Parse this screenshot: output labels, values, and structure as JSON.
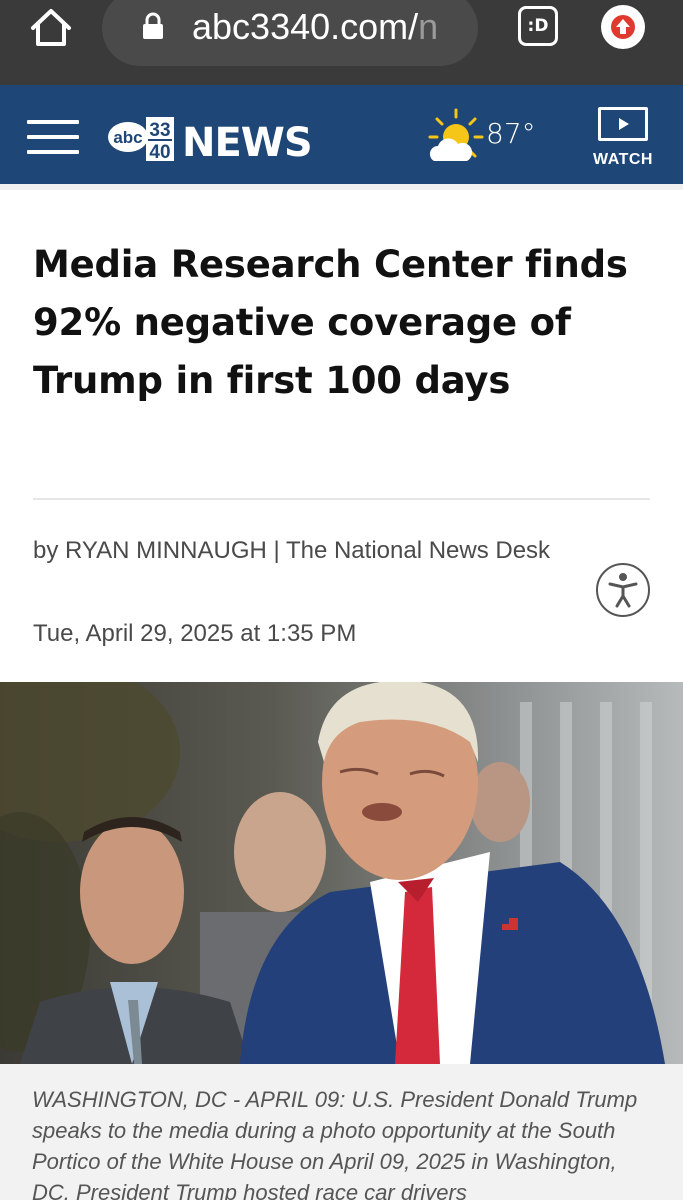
{
  "browser": {
    "url_main": "abc3340.com/",
    "url_fade": "n",
    "ext_label": ":D",
    "icons": [
      "home-icon",
      "lock-icon",
      "extension-icon",
      "upload-icon"
    ]
  },
  "header": {
    "logo_abc": "abc",
    "logo_num_top": "33",
    "logo_num_bottom": "40",
    "logo_news": "NEWS",
    "temperature": "87°",
    "watch_label": "WATCH",
    "colors": {
      "background": "#1e4676",
      "sun": "#f5c518"
    },
    "icons": [
      "menu-icon",
      "partly-sunny-icon",
      "play-icon"
    ]
  },
  "article": {
    "headline": "Media Research Center finds 92% negative coverage of Trump in first 100 days",
    "byline": "by RYAN MINNAUGH | The National News Desk",
    "date": "Tue, April 29, 2025 at 1:35 PM",
    "accessibility_icon": "accessibility-icon",
    "photo_caption": "WASHINGTON, DC - APRIL 09: U.S. President Donald Trump speaks to the media during a photo opportunity at the South Portico of the White House on April 09, 2025 in Washington, DC. President Trump hosted race car drivers"
  }
}
